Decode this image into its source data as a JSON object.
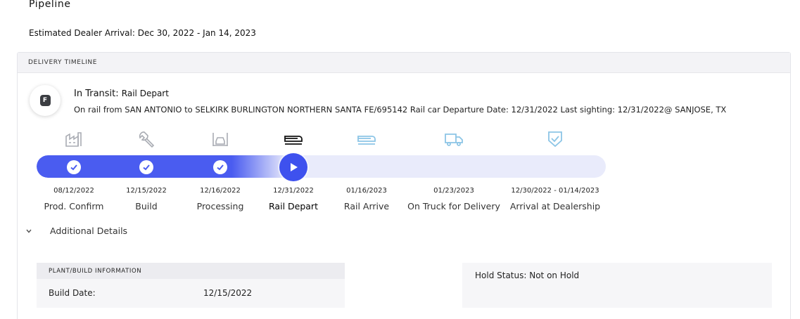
{
  "page": {
    "title": "Pipeline",
    "eta": "Estimated Dealer Arrival: Dec 30, 2022 - Jan 14, 2023"
  },
  "timeline": {
    "header": "DELIVERY TIMELINE",
    "badge_letter": "F",
    "status_label": "In Transit:",
    "status_sub": "Rail Depart",
    "status_detail": "On rail from SAN ANTONIO to SELKIRK BURLINGTON NORTHERN SANTA FE/695142 Rail car Departure Date: 12/31/2022 Last sighting: 12/31/2022@ SANJOSE, TX",
    "progress_fraction": 0.44,
    "milestones": [
      {
        "date": "08/12/2022",
        "label": "Prod. Confirm",
        "icon": "factory-icon",
        "state": "complete"
      },
      {
        "date": "12/15/2022",
        "label": "Build",
        "icon": "wrench-icon",
        "state": "complete"
      },
      {
        "date": "12/16/2022",
        "label": "Processing",
        "icon": "car-lift-icon",
        "state": "complete"
      },
      {
        "date": "12/31/2022",
        "label": "Rail Depart",
        "icon": "train-icon",
        "state": "current"
      },
      {
        "date": "01/16/2023",
        "label": "Rail Arrive",
        "icon": "train-icon",
        "state": "upcoming"
      },
      {
        "date": "01/23/2023",
        "label": "On Truck for Delivery",
        "icon": "truck-icon",
        "state": "upcoming"
      },
      {
        "date": "12/30/2022 - 01/14/2023",
        "label": "Arrival at Dealership",
        "icon": "shield-check-icon",
        "state": "upcoming"
      }
    ]
  },
  "additional": {
    "label": "Additional Details"
  },
  "plant": {
    "header": "PLANT/BUILD INFORMATION",
    "build_date_label": "Build Date:",
    "build_date_value": "12/15/2022"
  },
  "hold": {
    "text": "Hold Status: Not on Hold"
  },
  "colors": {
    "accent": "#3e51ee",
    "track": "#e9ebfb",
    "icon_done": "#a9acb3",
    "icon_current": "#111111",
    "icon_upcoming": "#8cc5e6"
  }
}
